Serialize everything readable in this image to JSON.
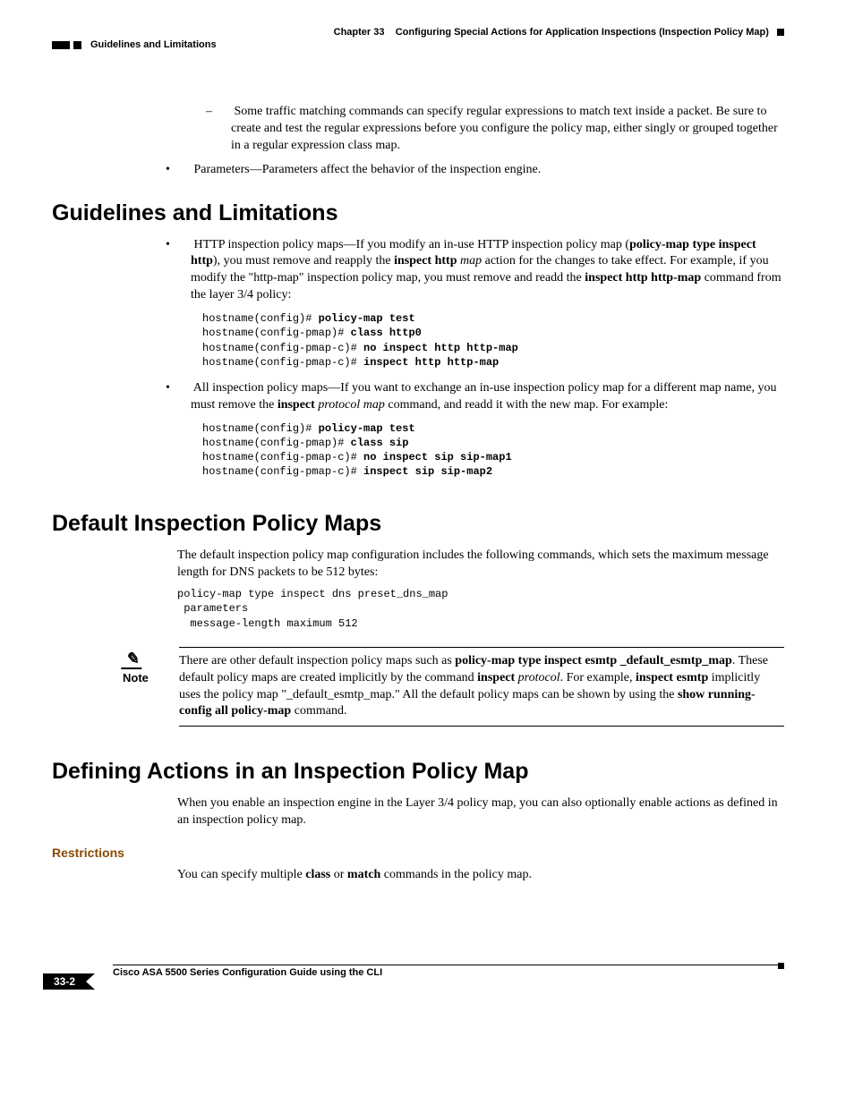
{
  "header": {
    "chapter": "Chapter 33",
    "chapter_title": "Configuring Special Actions for Application Inspections (Inspection Policy Map)",
    "running_section": "Guidelines and Limitations"
  },
  "content": {
    "pre_bullets": {
      "sub": "Some traffic matching commands can specify regular expressions to match text inside a packet. Be sure to create and test the regular expressions before you configure the policy map, either singly or grouped together in a regular expression class map.",
      "params": "Parameters—Parameters affect the behavior of the inspection engine."
    },
    "s1": {
      "heading": "Guidelines and Limitations",
      "b1_pre": "HTTP inspection policy maps—If you modify an in-use HTTP inspection policy map (",
      "b1_bold1": "policy-map type inspect http",
      "b1_mid1": "), you must remove and reapply the ",
      "b1_bold2": "inspect http",
      "b1_italic1": " map",
      "b1_mid2": " action for the changes to take effect. For example, if you modify the \"http-map\" inspection policy map, you must remove and readd the ",
      "b1_bold3": "inspect http http-map",
      "b1_post": " command from the layer 3/4 policy:",
      "code1": {
        "l1a": "hostname(config)# ",
        "l1b": "policy-map test",
        "l2a": "hostname(config-pmap)# ",
        "l2b": "class http0",
        "l3a": "hostname(config-pmap-c)# ",
        "l3b": "no inspect http http-map",
        "l4a": "hostname(config-pmap-c)# ",
        "l4b": "inspect http http-map"
      },
      "b2_pre": "All inspection policy maps—If you want to exchange an in-use inspection policy map for a different map name, you must remove the ",
      "b2_bold1": "inspect",
      "b2_italic1": " protocol map",
      "b2_mid1": " command, and readd it with the new map. For example:",
      "code2": {
        "l1a": "hostname(config)# ",
        "l1b": "policy-map test",
        "l2a": "hostname(config-pmap)# ",
        "l2b": "class sip",
        "l3a": "hostname(config-pmap-c)# ",
        "l3b": "no inspect sip sip-map1",
        "l4a": "hostname(config-pmap-c)# ",
        "l4b": "inspect sip sip-map2"
      }
    },
    "s2": {
      "heading": "Default Inspection Policy Maps",
      "p1": "The default inspection policy map configuration includes the following commands, which sets the maximum message length for DNS packets to be 512 bytes:",
      "code": "policy-map type inspect dns preset_dns_map\n parameters\n  message-length maximum 512",
      "note_label": "Note",
      "note_pre": "There are other default inspection policy maps such as ",
      "note_bold1": "policy-map type inspect esmtp _default_esmtp_map",
      "note_mid1": ". These default policy maps are created implicitly by the command ",
      "note_bold2": "inspect",
      "note_italic2": " protocol",
      "note_mid2": ". For example, ",
      "note_bold3": "inspect esmtp",
      "note_mid3": " implicitly uses the policy map \"_default_esmtp_map.\" All the default policy maps can be shown by using the ",
      "note_bold4": "show running-config all policy-map",
      "note_post": " command."
    },
    "s3": {
      "heading": "Defining Actions in an Inspection Policy Map",
      "p1": "When you enable an inspection engine in the Layer 3/4 policy map, you can also optionally enable actions as defined in an inspection policy map.",
      "sub_heading": "Restrictions",
      "p2_pre": "You can specify multiple ",
      "p2_bold1": "class",
      "p2_mid": " or ",
      "p2_bold2": "match",
      "p2_post": " commands in the policy map."
    }
  },
  "footer": {
    "doc_title": "Cisco ASA 5500 Series Configuration Guide using the CLI",
    "page_number": "33-2"
  }
}
